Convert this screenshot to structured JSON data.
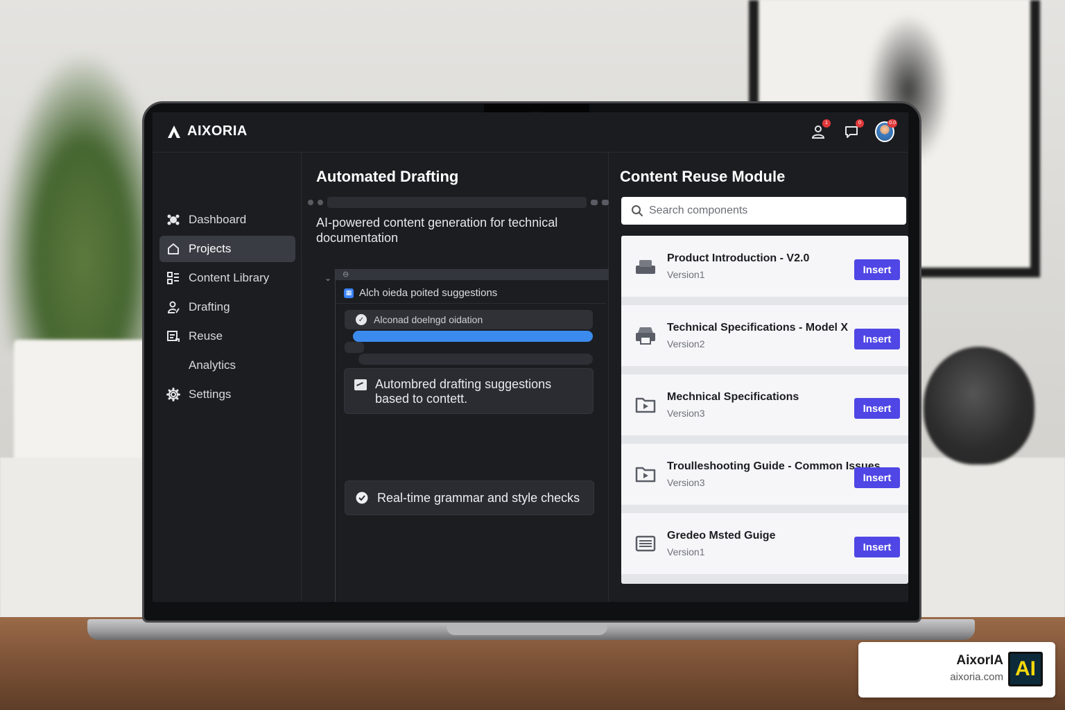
{
  "app": {
    "brand": "AIXORIA",
    "notifications": {
      "alerts_badge": "1",
      "messages_badge": "0",
      "avatar_badge": "0.0"
    }
  },
  "sidebar": {
    "items": [
      {
        "label": "Dashboard",
        "icon": "dashboard-icon",
        "active": false
      },
      {
        "label": "Projects",
        "icon": "home-icon",
        "active": true
      },
      {
        "label": "Content Library",
        "icon": "library-icon",
        "active": false
      },
      {
        "label": "Drafting",
        "icon": "user-pen-icon",
        "active": false
      },
      {
        "label": "Reuse",
        "icon": "reuse-icon",
        "active": false
      },
      {
        "label": "Analytics",
        "icon": "",
        "active": false
      },
      {
        "label": "Settings",
        "icon": "gear-icon",
        "active": false
      }
    ]
  },
  "drafting": {
    "title": "Automated Drafting",
    "description": "AI-powered content generation for technical documentation",
    "tree_header": "⊖",
    "tree_row": "Alch oieda poited suggestions",
    "suggestion_chip": "Alconad doelngd oidation",
    "progress": 1.0,
    "suggestion_card": "Autombred drafting suggestions based to contett.",
    "grammar_card": "Real-time grammar and style checks"
  },
  "reuse": {
    "title": "Content Reuse Module",
    "search_placeholder": "Search components",
    "insert_label": "Insert",
    "components": [
      {
        "name": "Product Introduction - V2.0",
        "version": "Version1",
        "icon": "box-stack-icon"
      },
      {
        "name": "Technical Specifications - Model X",
        "version": "Version2",
        "icon": "printer-icon"
      },
      {
        "name": "Mechnical Specifications",
        "version": "Version3",
        "icon": "folder-play-icon"
      },
      {
        "name": "Troulleshooting Guide - Common Issues",
        "version": "Version3",
        "icon": "folder-play-icon"
      },
      {
        "name": "Gredeo Msted Guige",
        "version": "Version1",
        "icon": "document-lines-icon"
      }
    ]
  },
  "watermark": {
    "name": "AixorIA",
    "url": "aixoria.com",
    "logo_text": "AI"
  }
}
